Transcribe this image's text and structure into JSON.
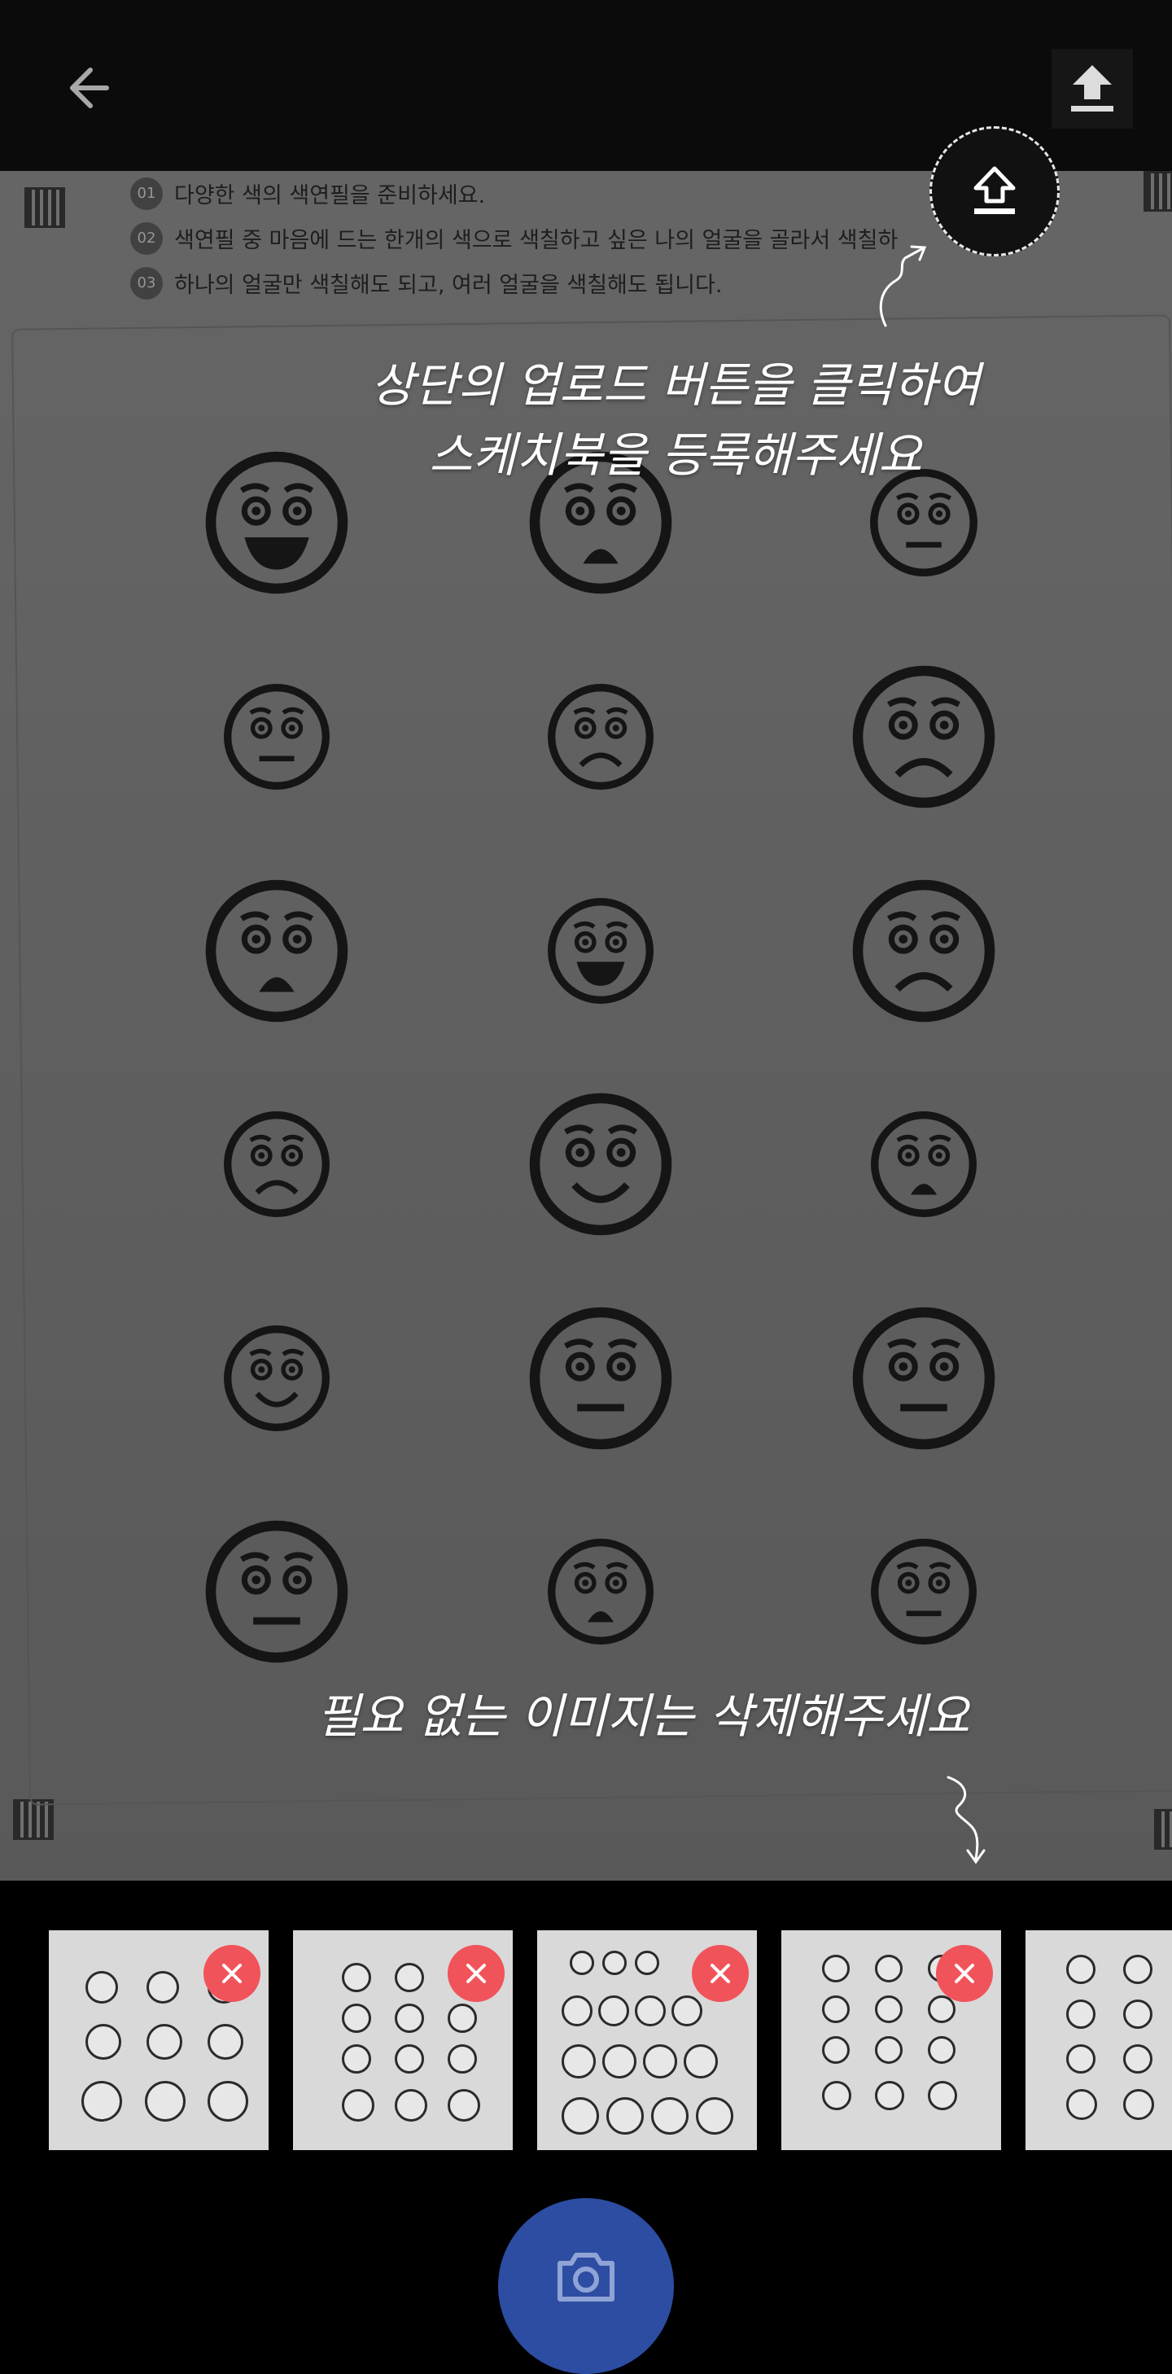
{
  "topbar": {
    "back_icon": "arrow-left-icon",
    "upload_icon": "upload-icon"
  },
  "instructions": [
    {
      "num": "01",
      "text": "다양한 색의 색연필을 준비하세요."
    },
    {
      "num": "02",
      "text": "색연필 중 마음에 드는 한개의 색으로 색칠하고 싶은 나의 얼굴을 골라서 색칠하"
    },
    {
      "num": "03",
      "text": "하나의 얼굴만 색칠해도 되고, 여러 얼굴을 색칠해도 됩니다."
    }
  ],
  "hints": {
    "upload_line1": "상단의 업로드 버튼을 클릭하여",
    "upload_line2": "스케치북을 등록해주세요",
    "delete": "필요 없는 이미지는 삭제해주세요"
  },
  "thumbnails": [
    {
      "delete_icon": "close-icon"
    },
    {
      "delete_icon": "close-icon"
    },
    {
      "delete_icon": "close-icon"
    },
    {
      "delete_icon": "close-icon"
    },
    {
      "delete_icon": "close-icon"
    }
  ],
  "bottom": {
    "camera_icon": "camera-icon"
  },
  "colors": {
    "accent_blue": "#2d4da2",
    "delete_red": "#f1535a"
  }
}
